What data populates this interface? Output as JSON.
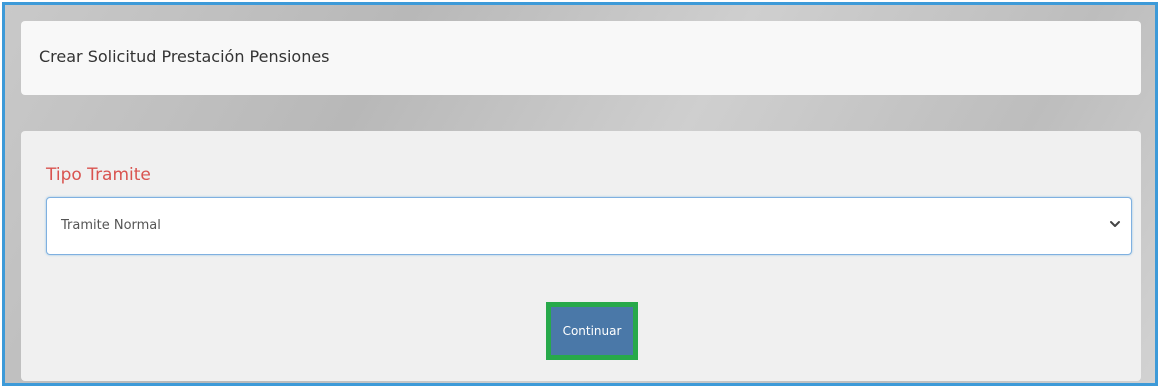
{
  "header": {
    "title": "Crear Solicitud Prestación Pensiones"
  },
  "form": {
    "field_label": "Tipo Tramite",
    "select_value": "Tramite Normal",
    "select_icon": "chevron-down-icon",
    "submit_label": "Continuar"
  },
  "colors": {
    "frame_border": "#3d9ad8",
    "label_red": "#d9534f",
    "button_blue": "#4a78a8",
    "highlight_green": "#27a94a"
  }
}
